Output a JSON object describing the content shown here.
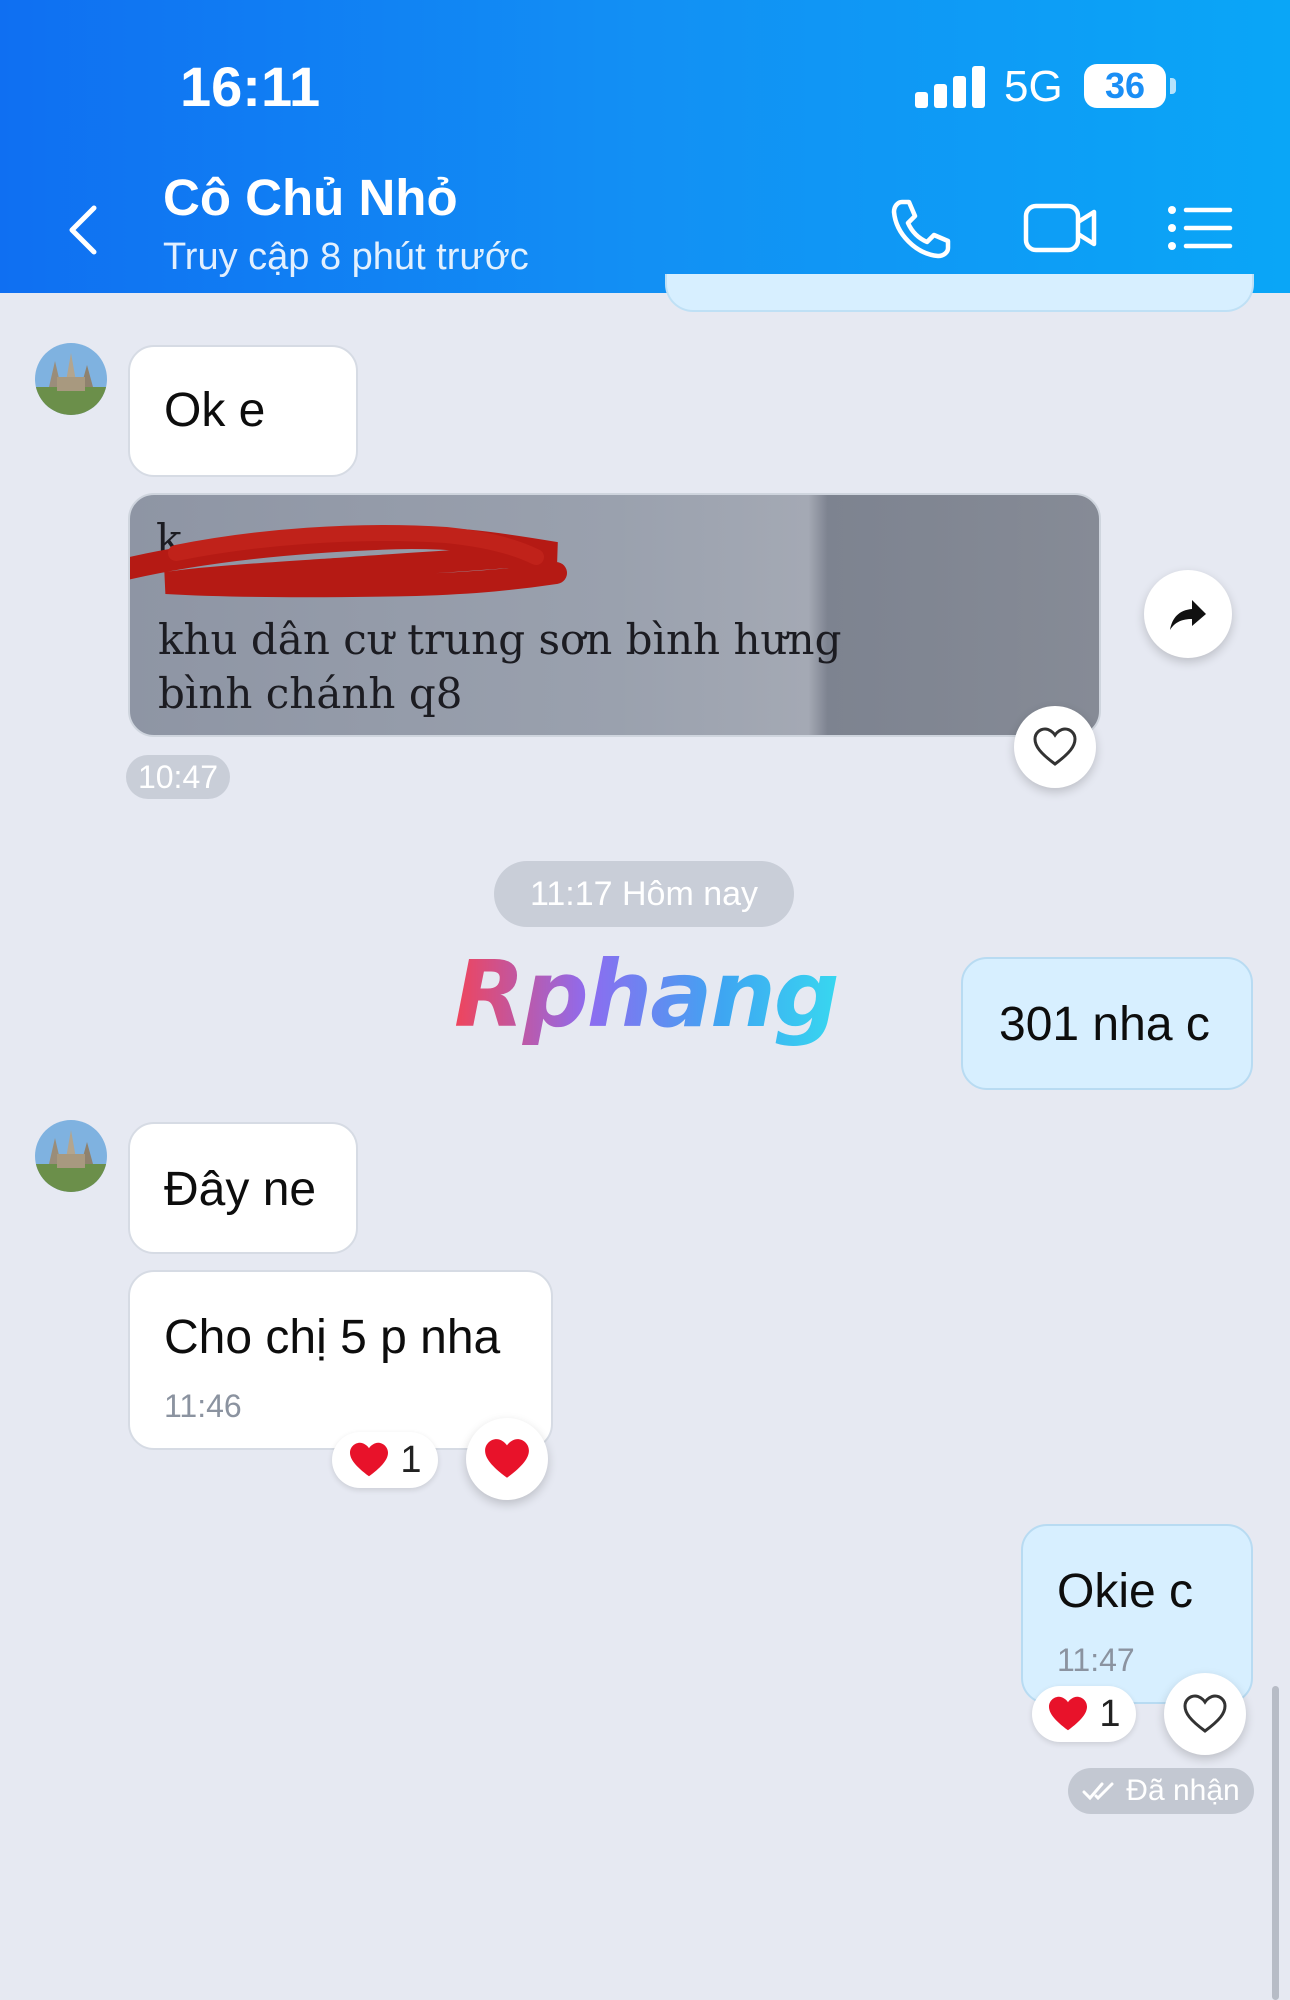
{
  "status_bar": {
    "time": "16:11",
    "network": "5G",
    "battery": "36"
  },
  "header": {
    "title": "Cô Chủ Nhỏ",
    "subtitle": "Truy cập 8 phút trước",
    "icons": [
      "back-icon",
      "phone-icon",
      "video-call-icon",
      "menu-list-icon"
    ]
  },
  "messages": {
    "m1_text": "Ok e",
    "image_lines": [
      "khu dân cư trung sơn bình hưng",
      "bình chánh q8"
    ],
    "image_time": "10:47",
    "time_separator": "11:17 Hôm nay",
    "m2_text": "301 nha c",
    "m3_text": "Đây ne",
    "m4_text": "Cho chị 5 p nha",
    "m4_time": "11:46",
    "m4_reaction_count": "1",
    "m5_text": "Okie c",
    "m5_time": "11:47",
    "m5_reaction_count": "1",
    "delivery_status": "Đã nhận"
  },
  "watermark": "Rphang",
  "colors": {
    "header_start": "#0f6ff2",
    "header_end": "#0aa6f7",
    "chat_bg": "#e6e9f2",
    "my_bubble": "#d7efff",
    "their_bubble": "#ffffff",
    "heart": "#e8122a"
  }
}
